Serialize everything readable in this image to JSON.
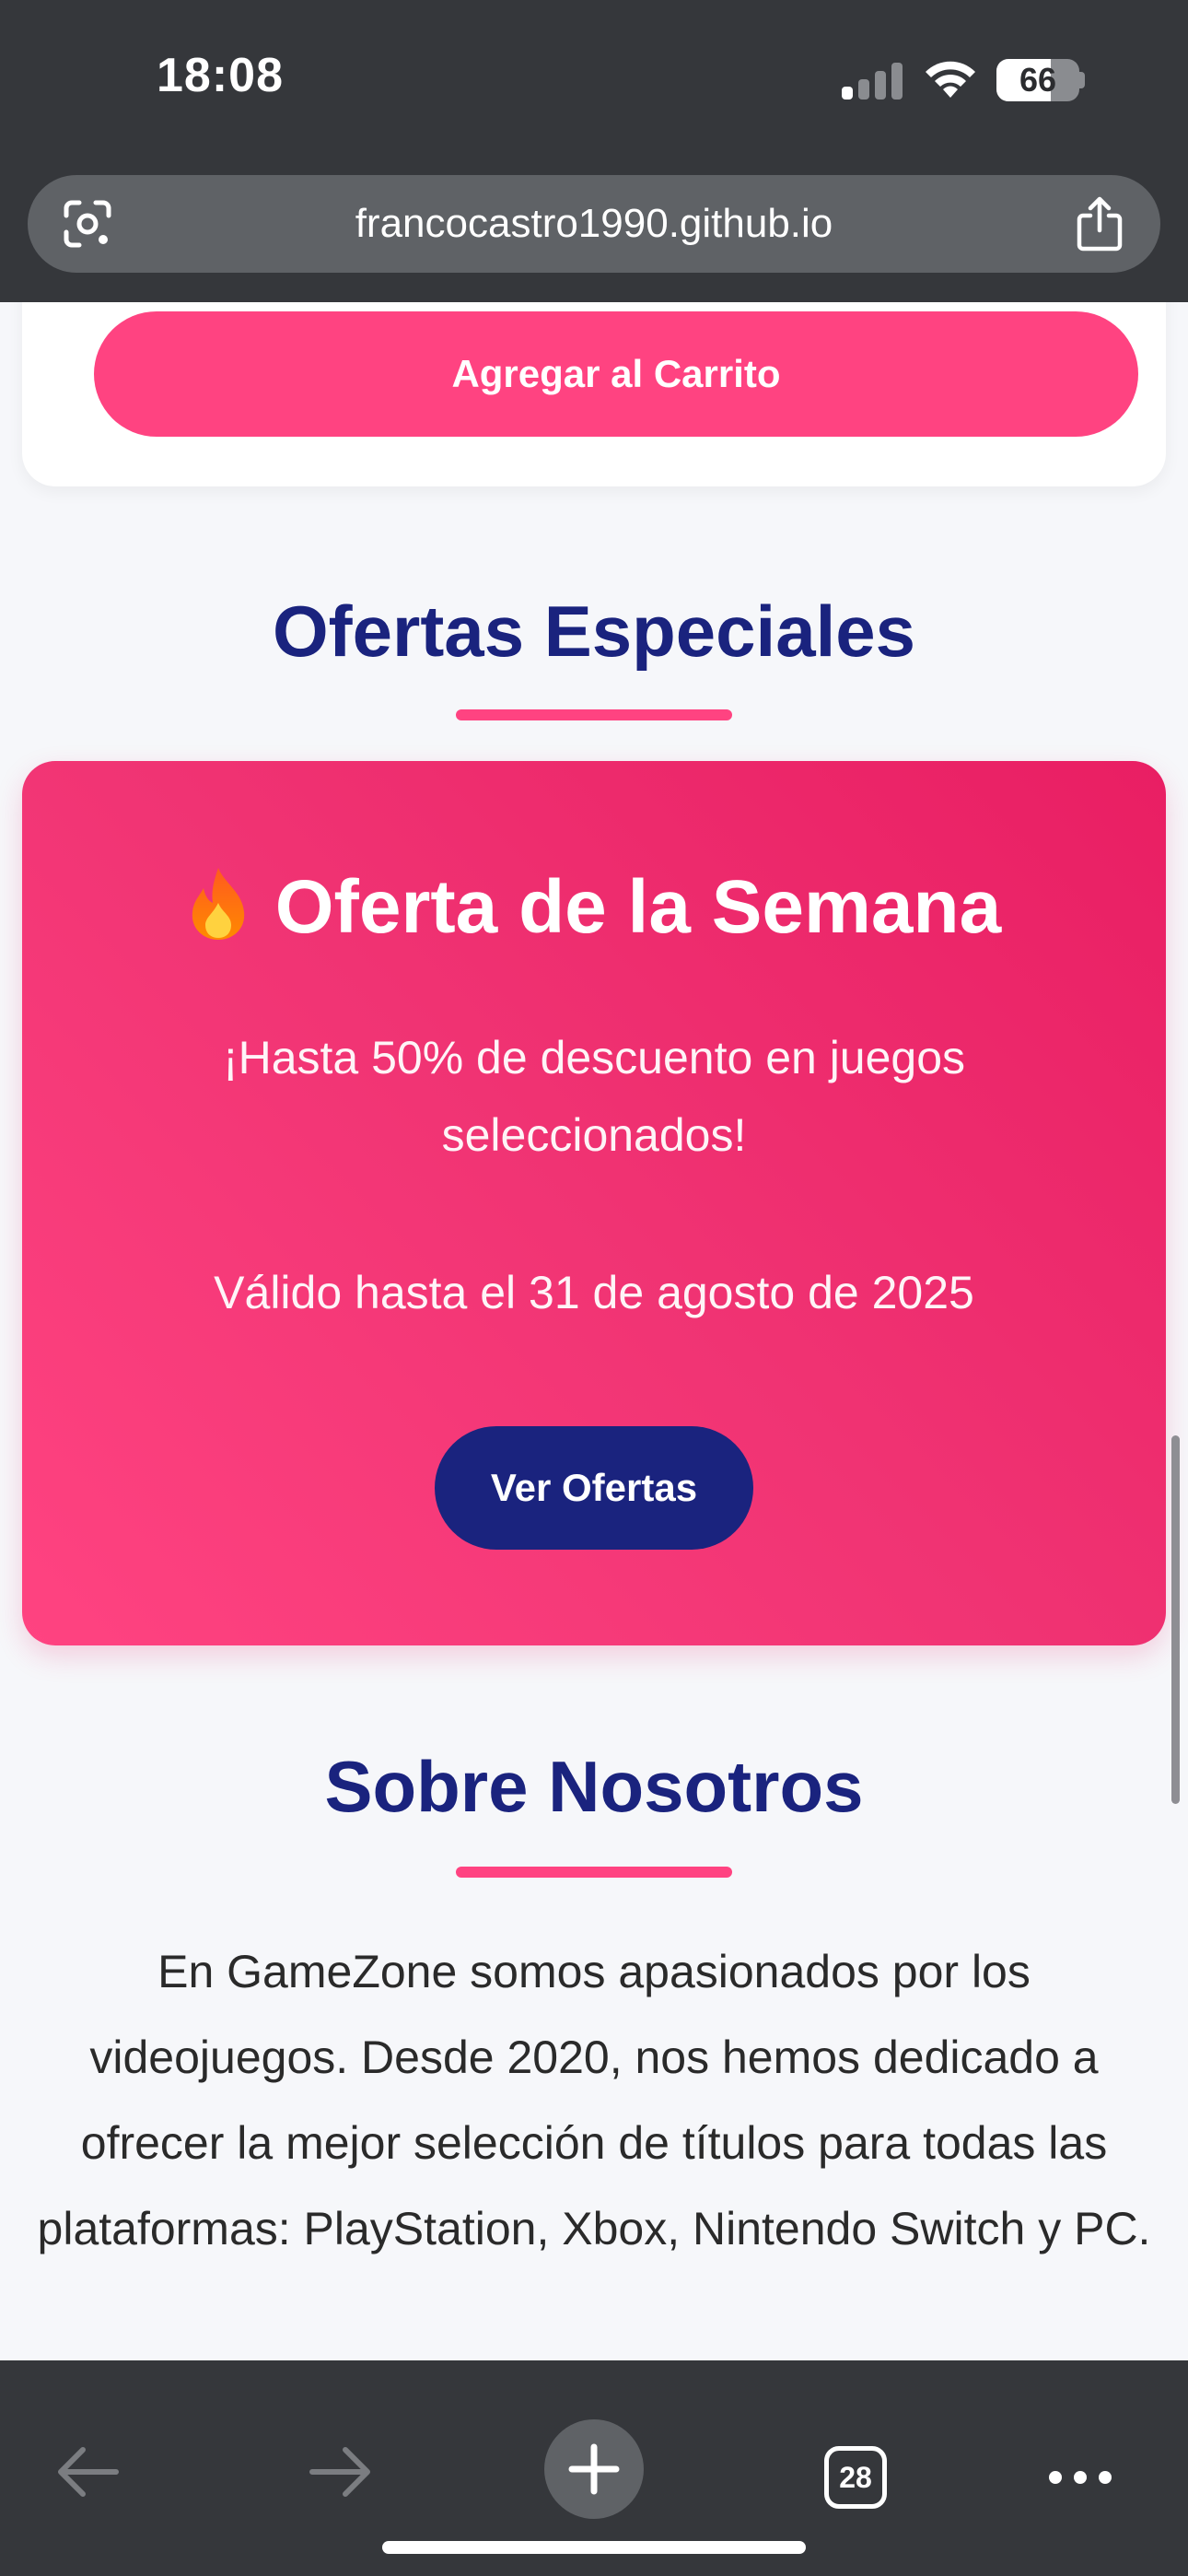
{
  "status_bar": {
    "time": "18:08",
    "battery_percent": "66",
    "signal_bars_active": 1,
    "signal_bars_total": 4
  },
  "browser": {
    "url": "francocastro1990.github.io",
    "tab_count": "28",
    "icons": {
      "left_of_url": "google-lens-icon",
      "right_of_url": "share-icon",
      "back": "arrow-left-icon",
      "forward": "arrow-right-icon",
      "new_tab": "plus-icon",
      "tabs": "tabs-icon",
      "more": "more-dots-icon"
    }
  },
  "page": {
    "product_card": {
      "add_to_cart_label": "Agregar al Carrito"
    },
    "offers_section": {
      "title": "Ofertas Especiales",
      "card": {
        "icon": "fire-icon",
        "heading": "Oferta de la Semana",
        "description": "¡Hasta 50% de descuento en juegos seleccionados!",
        "validity": "Válido hasta el 31 de agosto de 2025",
        "button_label": "Ver Ofertas"
      }
    },
    "about_section": {
      "title": "Sobre Nosotros",
      "text": "En GameZone somos apasionados por los videojuegos. Desde 2020, nos hemos dedicado a ofrecer la mejor selección de títulos para todas las plataformas: PlayStation, Xbox, Nintendo Switch y PC."
    }
  },
  "colors": {
    "accent_pink": "#ff4381",
    "offer_gradient_end": "#e91e63",
    "navy": "#1a237e",
    "chrome_dark": "#35373b",
    "page_bg": "#f6f7fa"
  }
}
